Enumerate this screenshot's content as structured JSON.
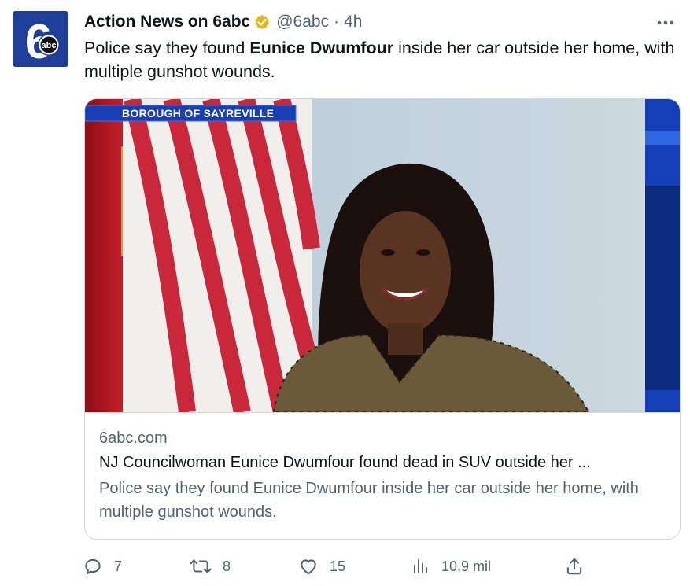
{
  "tweet": {
    "author": {
      "display_name": "Action News on 6abc",
      "handle": "@6abc",
      "time_ago": "4h",
      "separator": "·",
      "verified_icon": "verified-badge-gold-icon",
      "avatar_logo_text": "abc",
      "avatar_logo_number": "6"
    },
    "more_icon": "more-horizontal-icon",
    "text": {
      "before": "Police say they found ",
      "bold": "Eunice Dwumfour",
      "after": " inside her car outside her home, with multiple gunshot wounds."
    },
    "card": {
      "image": {
        "chyron": "BOROUGH OF SAYREVILLE",
        "description_icon": "news-photo"
      },
      "domain": "6abc.com",
      "title": "NJ Councilwoman Eunice Dwumfour found dead in SUV outside her ...",
      "description": "Police say they found Eunice Dwumfour inside her car outside her home, with multiple gunshot wounds."
    },
    "actions": {
      "reply": {
        "icon": "reply-icon",
        "count": "7"
      },
      "retweet": {
        "icon": "retweet-icon",
        "count": "8"
      },
      "like": {
        "icon": "heart-icon",
        "count": "15"
      },
      "views": {
        "icon": "views-chart-icon",
        "count": "10,9 mil"
      },
      "share": {
        "icon": "share-icon"
      }
    }
  },
  "colors": {
    "text_primary": "#0f1419",
    "text_secondary": "#536471",
    "border": "#cfd9de",
    "verified_gold": "#e2b719",
    "brand_blue": "#1d3f9a"
  }
}
